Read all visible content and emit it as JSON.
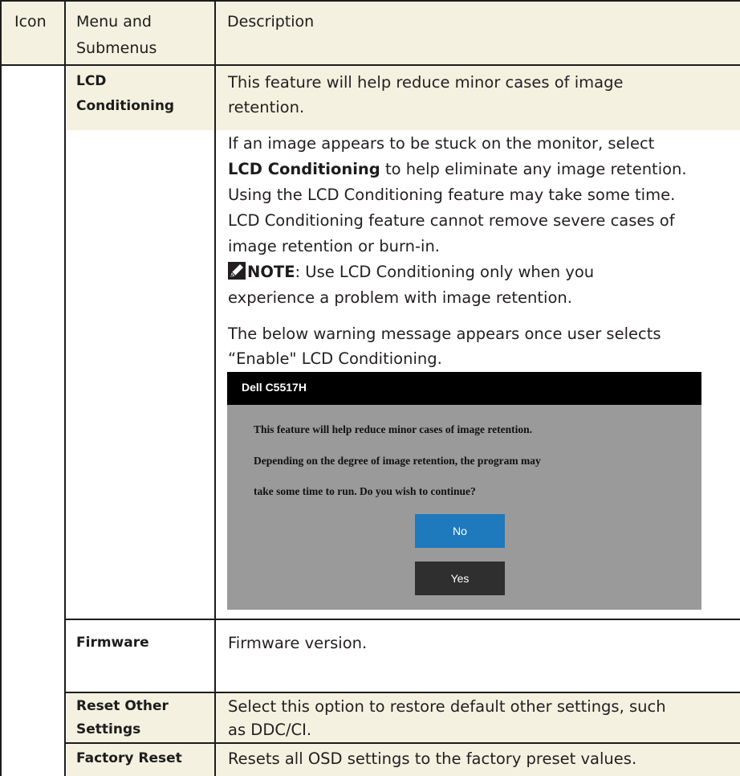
{
  "header": {
    "icon": "Icon",
    "menu_line1": "Menu and",
    "menu_line2": "Submenus",
    "description": "Description"
  },
  "lcd": {
    "menu_line1": "LCD",
    "menu_line2": "Conditioning",
    "p1_line1": "This feature will help reduce minor cases of image",
    "p1_line2": "retention.",
    "p2_line1": "If an image appears to be stuck on the monitor, select",
    "p2_bold": "LCD Conditioning",
    "p2_line2_rest": " to help eliminate any image retention.",
    "p2_line3": "Using the LCD Conditioning feature may take some time.",
    "p2_line4": "LCD Conditioning feature cannot remove  severe cases of",
    "p2_line5": "image retention or burn-in.",
    "note_label": "NOTE",
    "note_rest": ": Use LCD Conditioning only when you",
    "note_line2": "experience a problem with image retention.",
    "p3_line1": "The below warning message appears once user selects",
    "p3_line2": "“Enable\" LCD Conditioning.",
    "note_icon": "pencil-note-icon"
  },
  "dialog": {
    "title": "Dell C5517H",
    "line1": "This feature will help reduce minor cases of image retention.",
    "line2": "Depending on the degree of image retention, the program may",
    "line3": "take some time to run. Do you wish to continue?",
    "no_label": "No",
    "yes_label": "Yes",
    "colors": {
      "title_bg": "#000000",
      "body_bg": "#9a9a9a",
      "no_bg": "#1e79bd",
      "yes_bg": "#2f2f2f"
    }
  },
  "rows": [
    {
      "menu_line1": "Firmware",
      "menu_line2": "",
      "desc_line1": "Firmware version.",
      "desc_line2": ""
    },
    {
      "menu_line1": "Reset Other",
      "menu_line2": "Settings",
      "desc_line1": "Select this option to restore default other settings, such",
      "desc_line2": "as DDC/CI."
    },
    {
      "menu_line1": "Factory Reset",
      "menu_line2": "",
      "desc_line1": "Resets all OSD settings to the factory preset values.",
      "desc_line2": ""
    }
  ],
  "colors": {
    "header_band": "#f5f1e0",
    "rule": "#1c1c1c"
  }
}
